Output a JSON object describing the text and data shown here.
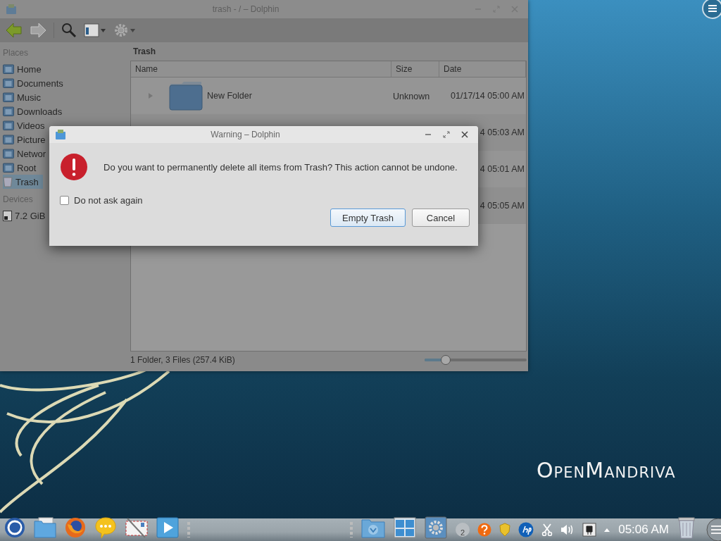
{
  "dolphin": {
    "title": "trash - / – Dolphin",
    "navigation": [
      {
        "disabled": false
      },
      {
        "disabled": true
      }
    ],
    "places": {
      "heading": "Places",
      "items": [
        {
          "label": "Home",
          "kind": "folder",
          "selected": false
        },
        {
          "label": "Documents",
          "kind": "folder",
          "selected": false
        },
        {
          "label": "Music",
          "kind": "folder",
          "selected": false
        },
        {
          "label": "Downloads",
          "kind": "folder",
          "selected": false
        },
        {
          "label": "Videos",
          "kind": "folder",
          "selected": false
        },
        {
          "label": "Picture",
          "kind": "folder",
          "selected": false
        },
        {
          "label": "Networ",
          "kind": "folder",
          "selected": false
        },
        {
          "label": "Root",
          "kind": "folder",
          "selected": false
        },
        {
          "label": "Trash",
          "kind": "trash",
          "selected": true
        }
      ]
    },
    "devices": {
      "heading": "Devices",
      "items": [
        {
          "label": "7.2 GiB"
        }
      ]
    },
    "location": "Trash",
    "columns": [
      "Name",
      "Size",
      "Date"
    ],
    "rows": [
      {
        "name": "New Folder",
        "size": "Unknown",
        "date": "01/17/14 05:00 AM"
      },
      {
        "date": "4 05:03 AM"
      },
      {
        "date": "4 05:01 AM"
      },
      {
        "date": "4 05:05 AM"
      }
    ],
    "status": "1 Folder, 3 Files (257.4 KiB)",
    "zoom": {
      "level": 0.21
    }
  },
  "dialog": {
    "title": "Warning – Dolphin",
    "message": "Do you want to permanently delete all items from Trash? This action cannot be undone.",
    "checkbox": {
      "label": "Do not ask again",
      "checked": false
    },
    "buttons": [
      {
        "label": "Empty Trash",
        "default": true
      },
      {
        "label": "Cancel",
        "default": false
      }
    ]
  },
  "logo": "OpenMandriva",
  "taskbar": {
    "tray": [
      {
        "kind": "updates",
        "text": "2"
      },
      {
        "kind": "help"
      },
      {
        "kind": "badge"
      },
      {
        "kind": "printer"
      },
      {
        "kind": "scissors"
      },
      {
        "kind": "volume"
      },
      {
        "kind": "network"
      },
      {
        "kind": "expand"
      }
    ],
    "clock": "05:06 AM"
  }
}
